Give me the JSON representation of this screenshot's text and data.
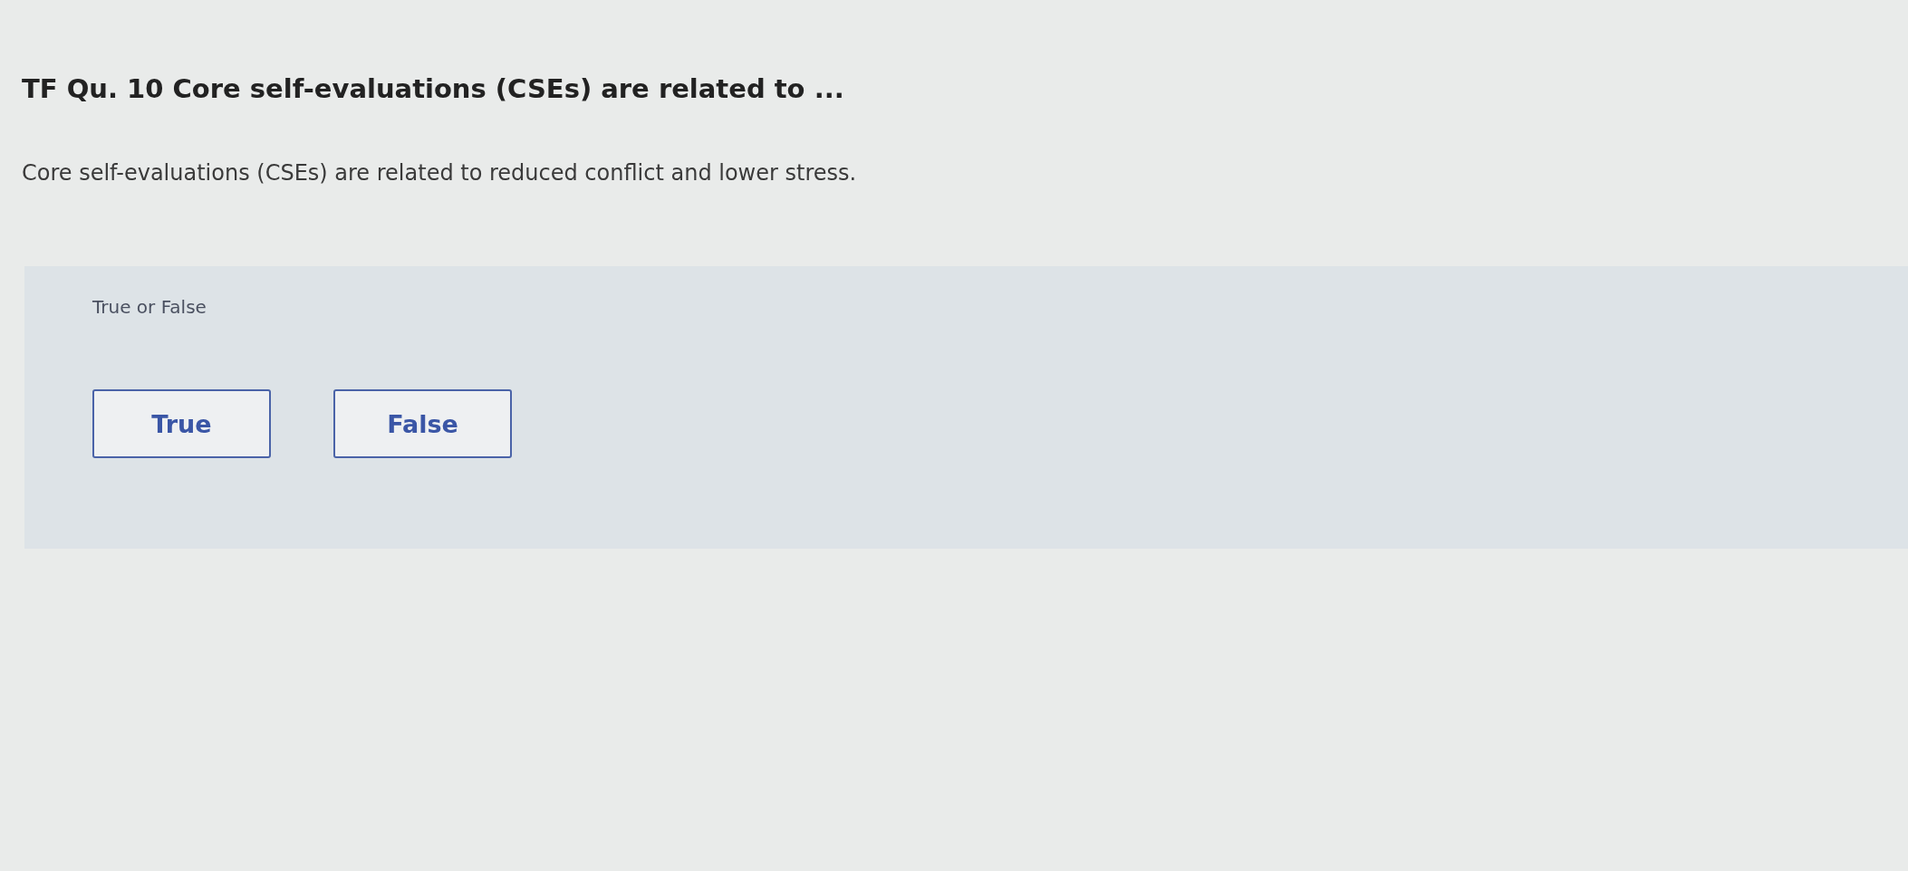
{
  "question": {
    "title": "TF Qu. 10 Core self-evaluations (CSEs) are related to ...",
    "statement": "Core self-evaluations (CSEs) are related to reduced conflict and lower stress."
  },
  "answer_panel": {
    "prompt": "True or False",
    "options": [
      {
        "label": "True",
        "selected": false
      },
      {
        "label": "False",
        "selected": false
      }
    ]
  }
}
